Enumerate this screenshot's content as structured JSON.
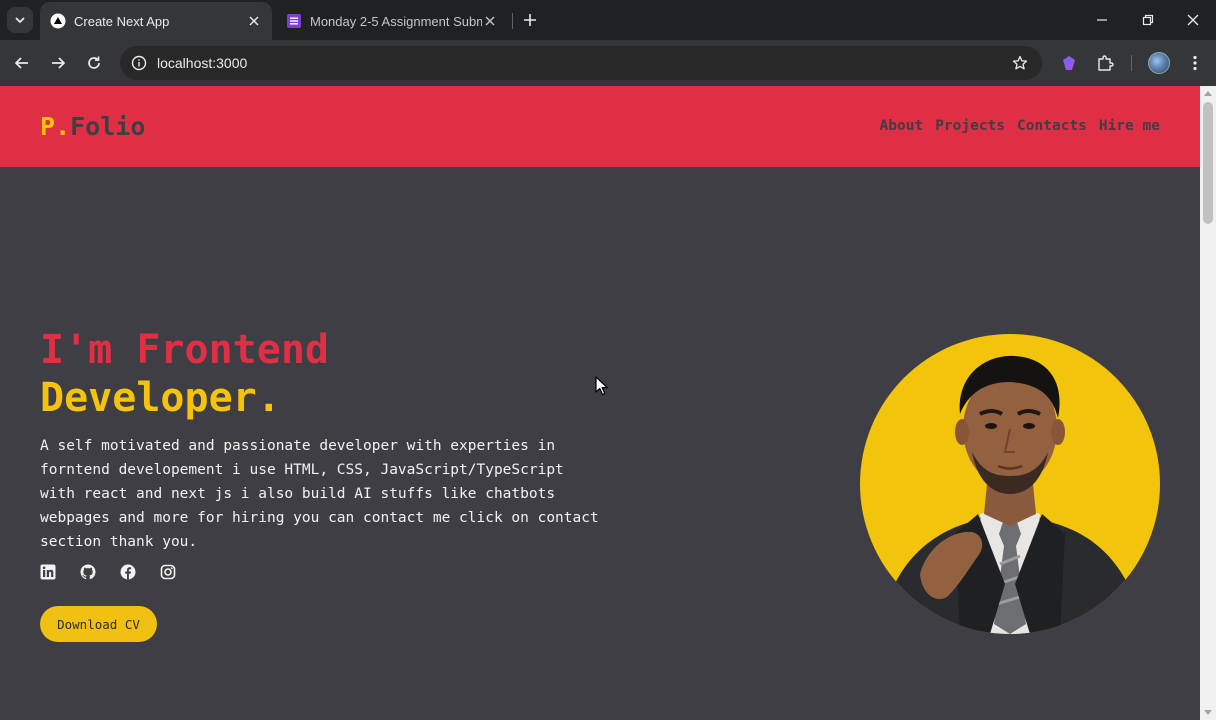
{
  "browser": {
    "tabs": [
      {
        "title": "Create Next App",
        "active": true,
        "favicon": "triangle-icon"
      },
      {
        "title": "Monday 2-5 Assignment Submi",
        "active": false,
        "favicon": "forms-icon"
      }
    ],
    "url": "localhost:3000"
  },
  "site": {
    "logo": {
      "p": "P",
      "dot": ".",
      "rest": "Folio"
    },
    "nav": [
      "About",
      "Projects",
      "Contacts",
      "Hire me"
    ],
    "hero": {
      "line1": "I'm Frontend",
      "line2": "Developer.",
      "description": "A self motivated and passionate developer with experties in forntend developement i use HTML, CSS, JavaScript/TypeScript with react and next js i also build AI stuffs like chatbots webpages and more for hiring you can contact me click on contact section thank you.",
      "socials": [
        "linkedin-icon",
        "github-icon",
        "facebook-icon",
        "instagram-icon"
      ],
      "cv_button": "Download CV"
    }
  },
  "colors": {
    "header_red": "#e02f44",
    "accent_yellow": "#f5c30b",
    "page_bg": "#3f3e45"
  }
}
